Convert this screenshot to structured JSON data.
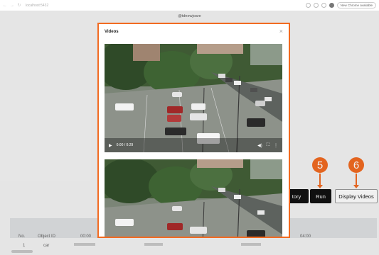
{
  "browser": {
    "nav_back": "←",
    "nav_forward": "→",
    "reload": "↻",
    "url": "localhost:5432",
    "update_label": "New Chrome available"
  },
  "app": {
    "title": "@tdnewjoare",
    "buttons": {
      "history_label": "tory",
      "run_label": "Run",
      "display_label": "Display Videos"
    },
    "markers": [
      "5",
      "6"
    ],
    "table": {
      "headers": [
        "No.",
        "Object ID"
      ],
      "times": [
        "00:00",
        "01:00",
        "02:00",
        "03:00",
        "04:00"
      ],
      "rows": [
        {
          "no": "1",
          "object": "car"
        }
      ]
    }
  },
  "modal": {
    "title": "Videos",
    "close": "×",
    "video1": {
      "time": "0:00 / 0:29",
      "play_icon": "▶",
      "volume_icon": "◀)",
      "fullscreen_icon": "⛶",
      "more_icon": "⋮"
    }
  },
  "colors": {
    "accent": "#f26b21",
    "dark_button": "#111111"
  }
}
